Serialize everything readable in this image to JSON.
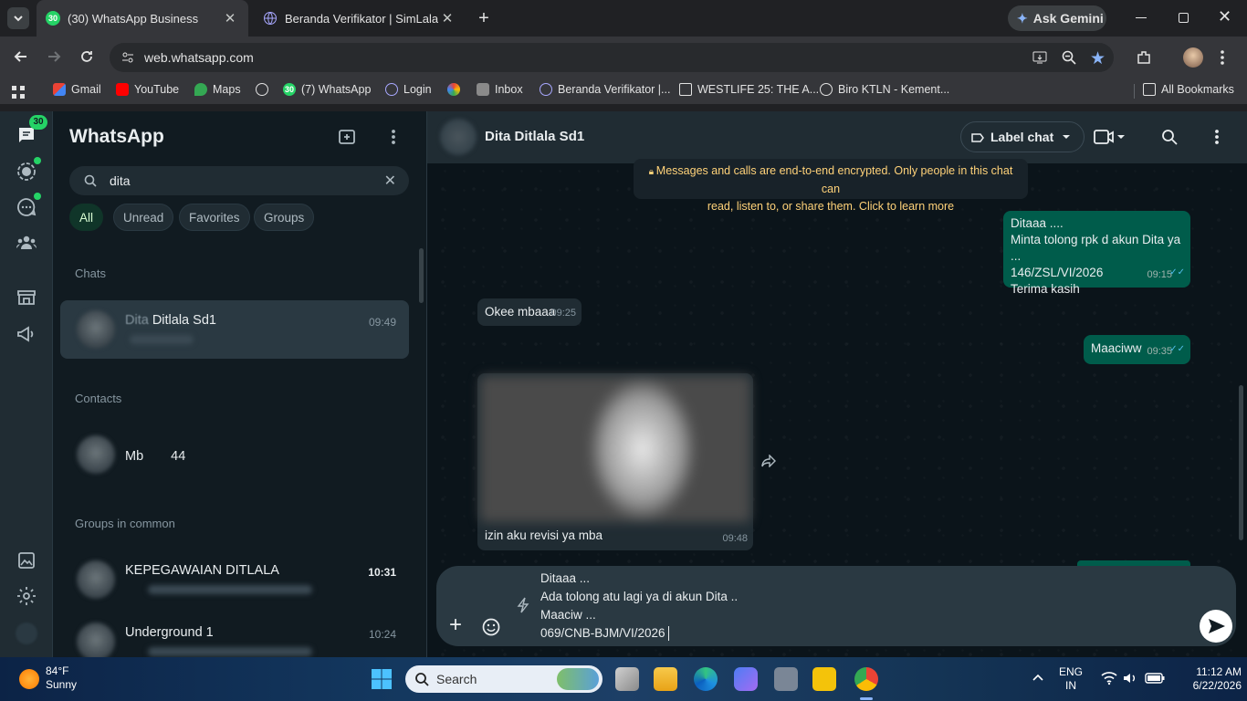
{
  "browser": {
    "tabs": [
      {
        "favicon_badge": "30",
        "title": "(30) WhatsApp Business",
        "active": true
      },
      {
        "title": "Beranda Verifikator | SimLala",
        "active": false
      }
    ],
    "gemini_label": "Ask Gemini",
    "url": "web.whatsapp.com",
    "bookmarks": [
      "Gmail",
      "YouTube",
      "Maps",
      "(7) WhatsApp",
      "Login",
      "Inbox",
      "Beranda Verifikator |...",
      "WESTLIFE 25: THE A...",
      "Biro KTLN - Kement..."
    ],
    "bookmark_badge": "30",
    "all_bookmarks": "All Bookmarks"
  },
  "app": {
    "rail_badge": "30",
    "title": "WhatsApp",
    "search_value": "dita",
    "filters": [
      "All",
      "Unread",
      "Favorites",
      "Groups"
    ],
    "sections": {
      "chats": "Chats",
      "contacts": "Contacts",
      "groups": "Groups in common"
    },
    "chat_results": [
      {
        "prefix": "Dita",
        "name": "Ditlala Sd1",
        "time": "09:49"
      }
    ],
    "contacts": [
      {
        "name": "Mb",
        "extra": "44"
      }
    ],
    "groups": [
      {
        "name": "KEPEGAWAIAN DITLALA",
        "time": "10:31"
      },
      {
        "name": "Underground 1",
        "time": "10:24"
      }
    ]
  },
  "chat": {
    "contact_name": "Dita Ditlala Sd1",
    "label_button": "Label chat",
    "encryption_line1": "Messages and calls are end-to-end encrypted. Only people in this chat can",
    "encryption_line2": "read, listen to, or share them. Click to learn more",
    "messages": [
      {
        "dir": "out",
        "lines": [
          "Ditaaa ....",
          "Minta tolong rpk d akun Dita ya ...",
          "146/ZSL/VI/2026",
          "Terima kasih"
        ],
        "time": "09:15"
      },
      {
        "dir": "in",
        "lines": [
          "Okee mbaaa"
        ],
        "time": "09:25"
      },
      {
        "dir": "out",
        "lines": [
          "Maaciww"
        ],
        "time": "09:35"
      },
      {
        "dir": "in",
        "lines": [
          "izin aku revisi ya mba"
        ],
        "time": "09:48"
      }
    ],
    "draft": [
      "Ditaaa ...",
      "Ada tolong atu lagi ya di akun Dita ..",
      "Maaciw ...",
      "069/CNB-BJM/VI/2026"
    ]
  },
  "taskbar": {
    "weather_temp": "84°F",
    "weather_desc": "Sunny",
    "search_label": "Search",
    "lang_top": "ENG",
    "lang_bottom": "IN",
    "time": "11:12 AM",
    "date": "6/22/2026"
  },
  "colors": {
    "accent": "#25d366",
    "bubble_out": "#005c4b",
    "bubble_in": "#202c33"
  }
}
